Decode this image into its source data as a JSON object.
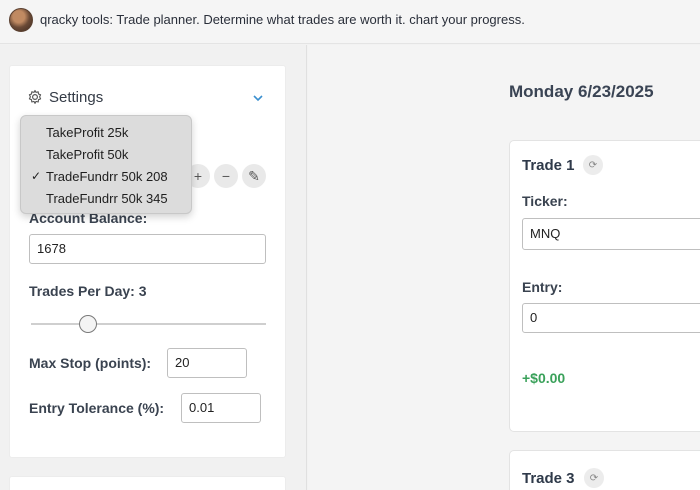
{
  "header": {
    "title": "qracky tools: Trade planner. Determine what trades are worth it. chart your progress."
  },
  "settings": {
    "title": "Settings",
    "account_options": [
      "TakeProfit 25k",
      "TakeProfit 50k",
      "TradeFundrr 50k 208",
      "TradeFundrr 50k 345"
    ],
    "selected_check": "✓",
    "add_label": "+",
    "remove_label": "−",
    "edit_label": "✎",
    "account_balance_label": "Account Balance:",
    "account_balance_value": "1678",
    "trades_per_day_label": "Trades Per Day: 3",
    "trades_per_day_level": 0.25,
    "max_stop_label": "Max Stop (points):",
    "max_stop_value": "20",
    "entry_tolerance_label": "Entry Tolerance (%):",
    "entry_tolerance_value": "0.01"
  },
  "main": {
    "date": "Monday 6/23/2025",
    "trades": [
      {
        "title": "Trade 1",
        "ticker_label": "Ticker:",
        "ticker_value": "MNQ",
        "entry_label": "Entry:",
        "entry_value": "0",
        "pnl": "+$0.00"
      },
      {
        "title": "Trade 3"
      }
    ],
    "refresh_glyph": "⟳"
  },
  "colors": {
    "pnl_positive": "#3aa15a",
    "accent": "#3a8fcf"
  }
}
